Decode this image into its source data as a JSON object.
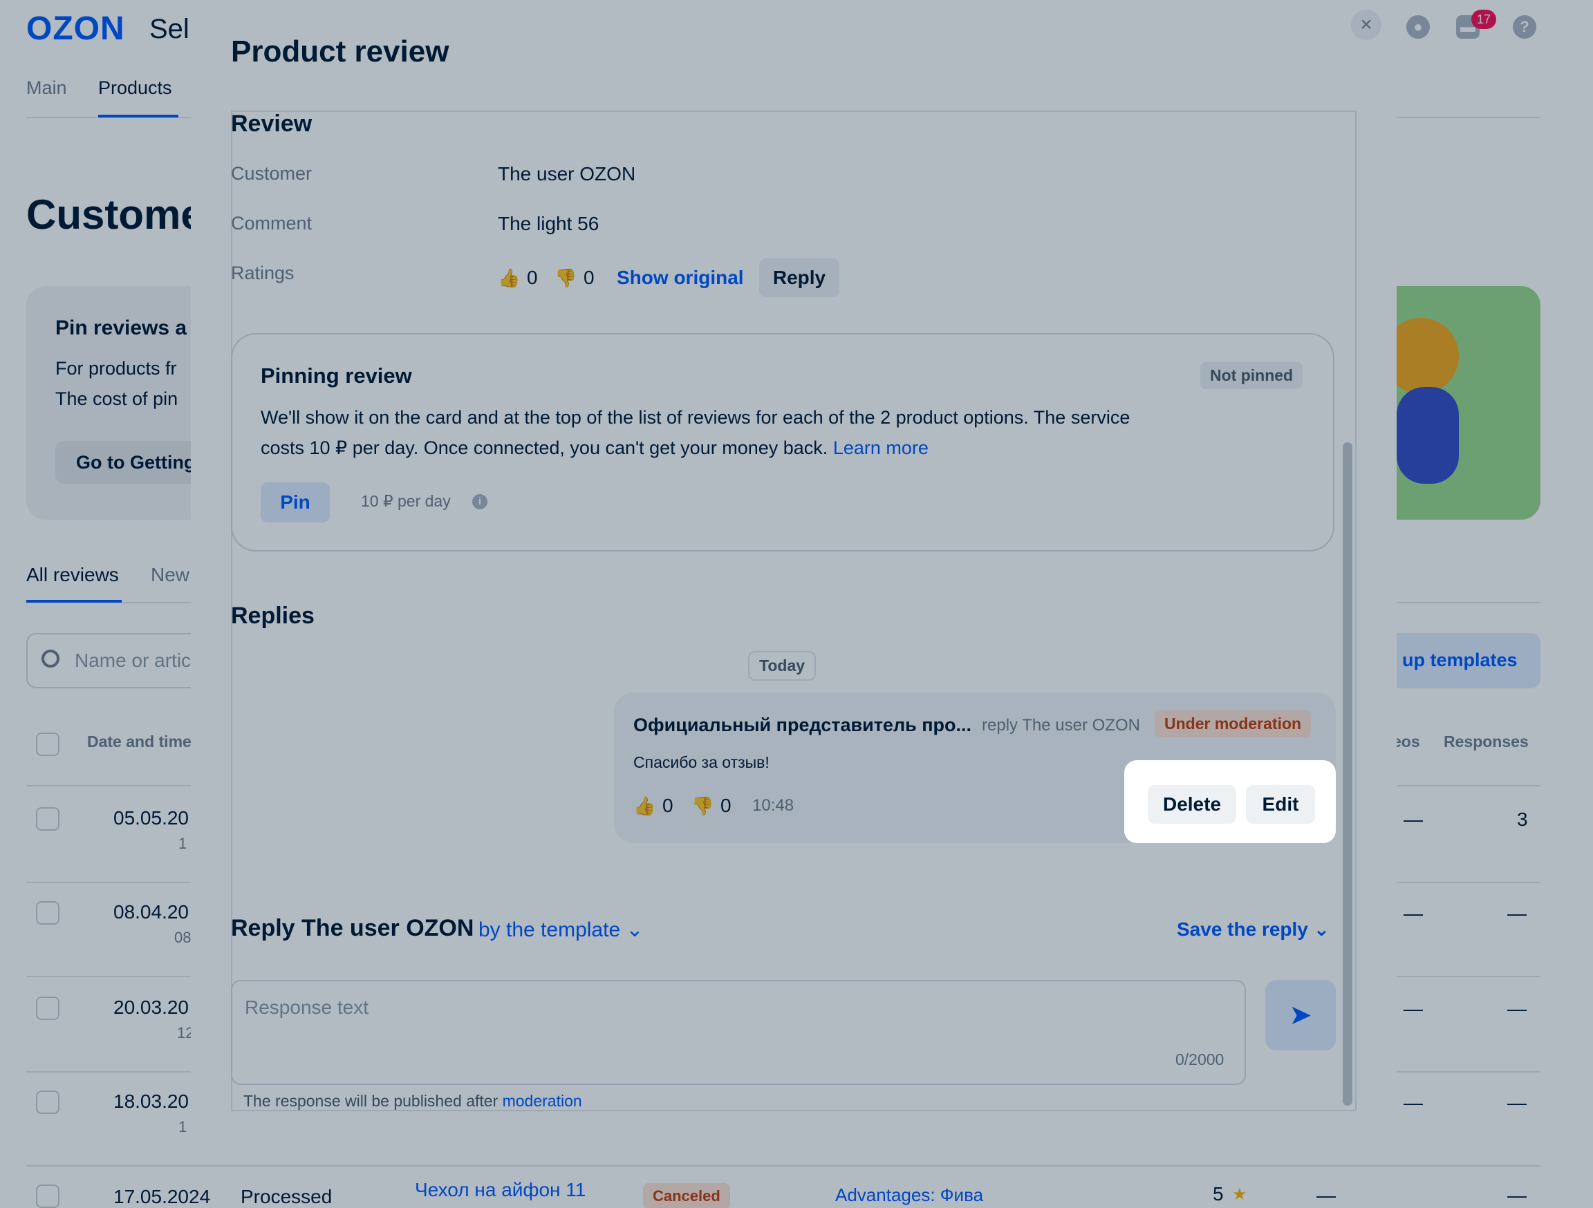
{
  "app": {
    "logo": "OZON",
    "logo_sub": "Seller",
    "badge_count": "17"
  },
  "nav": {
    "tabs": [
      "Main",
      "Products"
    ]
  },
  "page": {
    "title": "Customer reviews"
  },
  "promo": {
    "title": "Pin reviews a",
    "line1": "For products fr",
    "line2": "The cost of pin",
    "button": "Go to Getting"
  },
  "review_tabs": [
    "All reviews",
    "New"
  ],
  "search": {
    "placeholder": "Name or artic"
  },
  "templates_button": "up templates",
  "table": {
    "headers": {
      "date": "Date and time",
      "videos": "eos",
      "responses": "Responses"
    },
    "rows": [
      {
        "date": "05.05.20",
        "time": "1",
        "videos": "—",
        "responses": "3"
      },
      {
        "date": "08.04.20",
        "time": "08",
        "videos": "—",
        "responses": "—"
      },
      {
        "date": "20.03.20",
        "time": "12",
        "videos": "—",
        "responses": "—"
      },
      {
        "date": "18.03.20",
        "time": "1",
        "videos": "—",
        "responses": "—"
      }
    ],
    "last_row": {
      "date": "17.05.2024",
      "status": "Processed",
      "product": "Чехол на айфон 11",
      "order_status": "Canceled",
      "comment": "Advantages: Фива",
      "rating": "5",
      "dash1": "—",
      "dash2": "—"
    }
  },
  "modal": {
    "title": "Product review",
    "close_icon": "close-icon",
    "review": {
      "section_title": "Review",
      "customer_label": "Customer",
      "customer": "The user OZON",
      "comment_label": "Comment",
      "comment": "The light 56",
      "ratings_label": "Ratings",
      "likes": "0",
      "dislikes": "0",
      "show_original": "Show original",
      "reply_button": "Reply"
    },
    "pinning": {
      "title": "Pinning review",
      "status": "Not pinned",
      "text": "We'll show it on the card and at the top of the list of reviews for each of the 2 product options. The service costs 10 ₽ per day. Once connected, you can't get your money back.",
      "learn_more": "Learn more",
      "pin_button": "Pin",
      "price": "10 ₽  per day"
    },
    "replies": {
      "section_title": "Replies",
      "date_divider": "Today",
      "items": [
        {
          "author": "Официальный представитель про...",
          "reply_to": "reply The user OZON",
          "status": "Under moderation",
          "text": "Спасибо за отзыв!",
          "likes": "0",
          "dislikes": "0",
          "time": "10:48",
          "delete": "Delete",
          "edit": "Edit"
        }
      ]
    },
    "compose": {
      "heading": "Reply The user OZON",
      "by_template": "by the template",
      "save_reply": "Save the reply",
      "placeholder": "Response text",
      "counter": "0/2000",
      "note": "The response will be published after",
      "note_link": "moderation"
    }
  },
  "colors": {
    "accent": "#005bff",
    "moderation": "#c23f0c",
    "overlay": "rgba(0,26,52,0.3)"
  }
}
